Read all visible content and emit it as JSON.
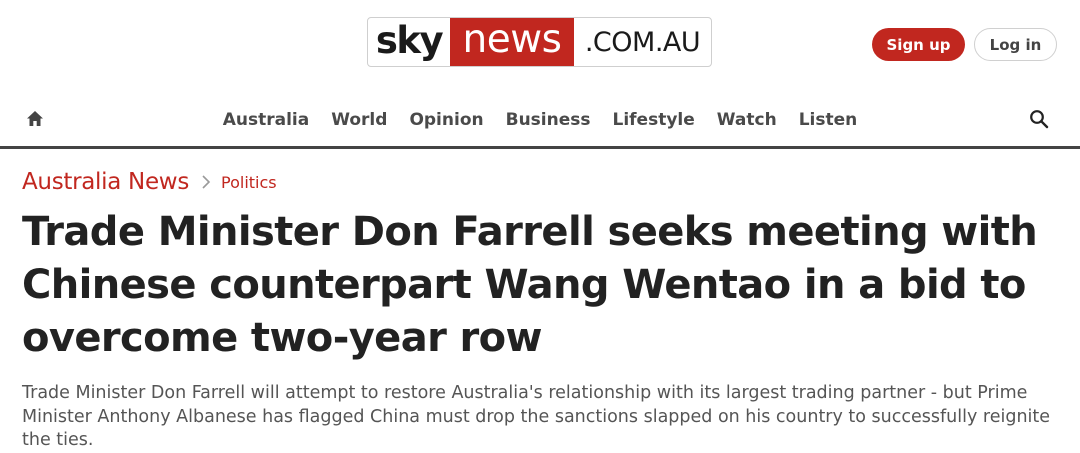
{
  "header": {
    "logo": {
      "sky": "sky",
      "news": "news",
      "domain": ".COM.AU"
    },
    "signup_label": "Sign up",
    "login_label": "Log in",
    "brand_color": "#c1271f"
  },
  "nav": {
    "home_icon": "home-icon",
    "items": [
      {
        "label": "Australia"
      },
      {
        "label": "World"
      },
      {
        "label": "Opinion"
      },
      {
        "label": "Business"
      },
      {
        "label": "Lifestyle"
      },
      {
        "label": "Watch"
      },
      {
        "label": "Listen"
      }
    ],
    "search_icon": "search-icon"
  },
  "article": {
    "breadcrumb": {
      "section": "Australia News",
      "subsection": "Politics"
    },
    "headline": "Trade Minister Don Farrell seeks meeting with Chinese counterpart Wang Wentao in a bid to overcome two-year row",
    "standfirst": "Trade Minister Don Farrell will attempt to restore Australia's relationship with its largest trading partner - but Prime Minister Anthony Albanese has flagged China must drop the sanctions slapped on his country to successfully reignite the ties."
  }
}
